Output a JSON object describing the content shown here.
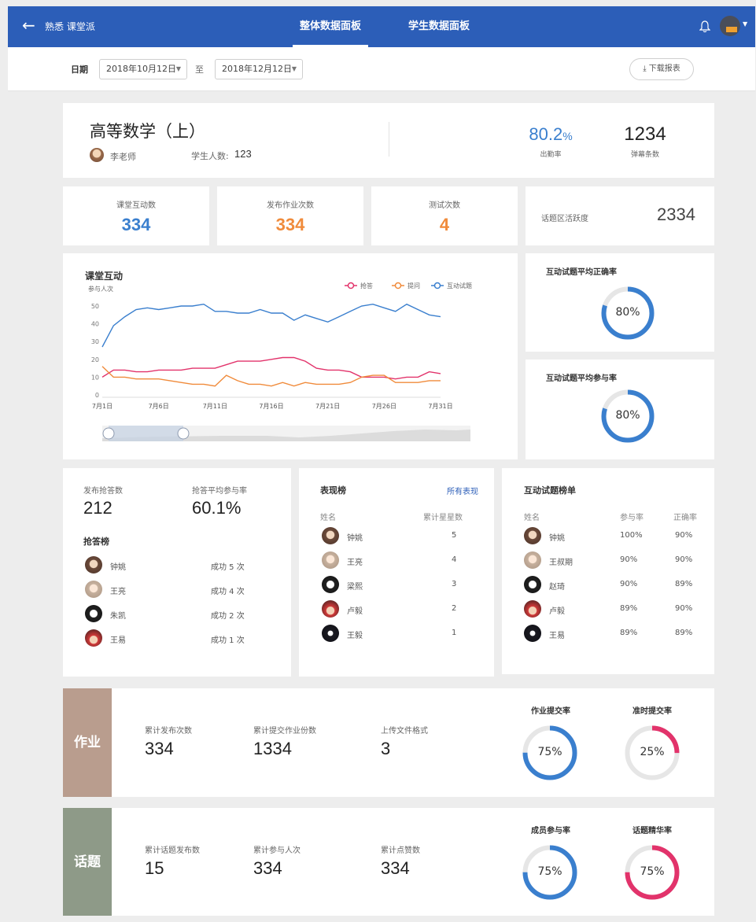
{
  "app": {
    "title": "熟悉 课堂派"
  },
  "tabs": [
    {
      "label": "整体数据面板",
      "active": true
    },
    {
      "label": "学生数据面板",
      "active": false
    }
  ],
  "filter": {
    "date_label": "日期",
    "start_date": "2018年10月12日",
    "to_label": "至",
    "end_date": "2018年12月12日",
    "download_label": "下载报表"
  },
  "course": {
    "title": "高等数学（上）",
    "teacher": "李老师",
    "students_label": "学生人数:",
    "students_value": "123",
    "attendance_value": "80.2",
    "attendance_unit": "%",
    "attendance_label": "出勤率",
    "danmu_value": "1234",
    "danmu_label": "弹幕条数"
  },
  "stats": {
    "interaction": {
      "label": "课堂互动数",
      "value": "334"
    },
    "homework": {
      "label": "发布作业次数",
      "value": "334"
    },
    "tests": {
      "label": "测试次数",
      "value": "4"
    },
    "topic": {
      "label": "话题区活跃度",
      "value": "2334"
    }
  },
  "colors": {
    "blue": "#3a7fce",
    "orange": "#f08b3b",
    "pink": "#e2336b",
    "primary": "#2c5eb8"
  },
  "chart_data": {
    "type": "line",
    "title": "课堂互动",
    "ylabel": "参与人次",
    "ylim": [
      0,
      50
    ],
    "yticks": [
      "0",
      "10",
      "20",
      "30",
      "40",
      "50"
    ],
    "x": [
      1,
      2,
      3,
      4,
      5,
      6,
      7,
      8,
      9,
      10,
      11,
      12,
      13,
      14,
      15,
      16,
      17,
      18,
      19,
      20,
      21,
      22,
      23,
      24,
      25,
      26,
      27,
      28,
      29,
      30,
      31
    ],
    "xticks": [
      "7月1日",
      "7月6日",
      "7月11日",
      "7月16日",
      "7月21日",
      "7月26日",
      "7月31日"
    ],
    "legend_position": "top-right",
    "series": [
      {
        "name": "抢答",
        "color": "#e2336b",
        "values": [
          10,
          14,
          14,
          13,
          13,
          14,
          14,
          14,
          15,
          15,
          15,
          17,
          19,
          19,
          19,
          20,
          21,
          21,
          19,
          15,
          14,
          14,
          13,
          10,
          10,
          10,
          9,
          10,
          10,
          13,
          12
        ]
      },
      {
        "name": "提问",
        "color": "#f08b3b",
        "values": [
          16,
          10,
          10,
          9,
          9,
          9,
          8,
          7,
          6,
          6,
          5,
          11,
          8,
          6,
          6,
          5,
          7,
          5,
          7,
          6,
          6,
          6,
          7,
          10,
          11,
          11,
          7,
          7,
          7,
          8,
          8
        ]
      },
      {
        "name": "互动试题",
        "color": "#3a7fce",
        "values": [
          27,
          39,
          44,
          48,
          49,
          48,
          49,
          50,
          50,
          51,
          47,
          47,
          46,
          46,
          48,
          46,
          46,
          42,
          45,
          43,
          41,
          44,
          47,
          50,
          51,
          49,
          47,
          51,
          48,
          45,
          44
        ]
      }
    ]
  },
  "rings": {
    "accuracy": {
      "label": "互动试题平均正确率",
      "percent": 80,
      "text": "80%"
    },
    "participation": {
      "label": "互动试题平均参与率",
      "percent": 80,
      "text": "80%"
    }
  },
  "quick": {
    "count_label": "发布抢答数",
    "count_value": "212",
    "rate_label": "抢答平均参与率",
    "rate_value": "60.1%",
    "board_title": "抢答榜",
    "rows": [
      {
        "name": "钟姚",
        "result": "成功 5 次"
      },
      {
        "name": "王亮",
        "result": "成功 4 次"
      },
      {
        "name": "朱凯",
        "result": "成功 2 次"
      },
      {
        "name": "王易",
        "result": "成功 1 次"
      }
    ]
  },
  "performance": {
    "title": "表现榜",
    "link": "所有表现",
    "col_name": "姓名",
    "col_stars": "累计星星数",
    "rows": [
      {
        "name": "钟姚",
        "stars": "5"
      },
      {
        "name": "王亮",
        "stars": "4"
      },
      {
        "name": "梁熙",
        "stars": "3"
      },
      {
        "name": "卢毅",
        "stars": "2"
      },
      {
        "name": "王毅",
        "stars": "1"
      }
    ]
  },
  "quiz_board": {
    "title": "互动试题榜单",
    "col_name": "姓名",
    "col_part": "参与率",
    "col_acc": "正确率",
    "rows": [
      {
        "name": "钟姚",
        "part": "100%",
        "acc": "90%"
      },
      {
        "name": "王叔期",
        "part": "90%",
        "acc": "90%"
      },
      {
        "name": "赵琦",
        "part": "90%",
        "acc": "89%"
      },
      {
        "name": "卢毅",
        "part": "89%",
        "acc": "90%"
      },
      {
        "name": "王易",
        "part": "89%",
        "acc": "89%"
      }
    ]
  },
  "homework_section": {
    "tag": "作业",
    "items": [
      {
        "label": "累计发布次数",
        "value": "334"
      },
      {
        "label": "累计提交作业份数",
        "value": "1334"
      },
      {
        "label": "上传文件格式",
        "value": "3"
      }
    ],
    "ring1": {
      "label": "作业提交率",
      "percent": 75,
      "text": "75%"
    },
    "ring2": {
      "label": "准时提交率",
      "percent": 25,
      "text": "25%"
    }
  },
  "topic_section": {
    "tag": "话题",
    "items": [
      {
        "label": "累计话题发布数",
        "value": "15"
      },
      {
        "label": "累计参与人次",
        "value": "334"
      },
      {
        "label": "累计点赞数",
        "value": "334"
      }
    ],
    "ring1": {
      "label": "成员参与率",
      "percent": 75,
      "text": "75%"
    },
    "ring2": {
      "label": "话题精华率",
      "percent": 75,
      "text": "75%"
    }
  }
}
